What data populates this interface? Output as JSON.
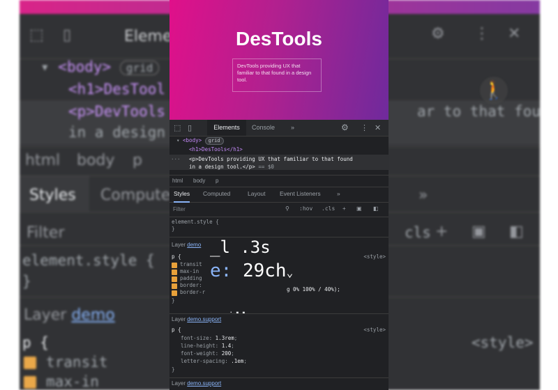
{
  "preview": {
    "heading": "DesTools",
    "description": "DevTools providing UX that familiar to that found in a design tool."
  },
  "toolbar": {
    "tabs": [
      "Elements",
      "Console"
    ],
    "more_label": "»"
  },
  "dom_tree": {
    "body_tag": "<body>",
    "body_badge": "grid",
    "h1_line": "<h1>DesTools</h1>",
    "p_line_1": "<p>DevTools providing UX that familiar to that found",
    "p_line_2": "in a design tool.</p>",
    "p_suffix": "== $0"
  },
  "breadcrumbs": [
    "html",
    "body",
    "p"
  ],
  "styles_tabs": [
    "Styles",
    "Computed",
    "Layout",
    "Event Listeners",
    "»"
  ],
  "filter": {
    "placeholder": "Filter",
    "hov": ":hov",
    "cls": ".cls",
    "plus": "+"
  },
  "styles": {
    "element_style": "element.style {",
    "close_brace": "}",
    "layer_label": "Layer",
    "layer_demo": "demo",
    "layer_demo_support": "demo.support",
    "selector_p": "p {",
    "style_src": "<style>",
    "rule1_props": [
      "transit",
      "max-in",
      "padding",
      "border:",
      "border-r"
    ],
    "rule1_value_tail": "g 0% 100% / 40%);",
    "rule2_props": [
      {
        "name": "font-size",
        "value": "1.3rem"
      },
      {
        "name": "line-height",
        "value": "1.4"
      },
      {
        "name": "font-weight",
        "value": "200"
      },
      {
        "name": "letter-spacing",
        "value": ".1em"
      }
    ]
  },
  "overlay": {
    "line1": "_l .3s",
    "line2_prefix": "e:",
    "line2_value": "29ch"
  },
  "background": {
    "elements_tab": "Eleme",
    "body_tag": "<body>",
    "badge": "grid",
    "h1": "<h1>DesTool",
    "p1": "<p>DevTools",
    "p2": "in a design",
    "p_tail": "ar to that found",
    "crumbs": [
      "html",
      "body",
      "p"
    ],
    "styles_tab": "Styles",
    "computed_tab": "Compute",
    "filter": "Filter",
    "element_style": "element.style {",
    "close": "}",
    "layer": "Layer",
    "layer_link": "demo",
    "p_open": "p {",
    "style_src": "<style>",
    "prop1": "transit",
    "prop2": "max-in",
    "cls": "cls",
    "more": "»"
  }
}
